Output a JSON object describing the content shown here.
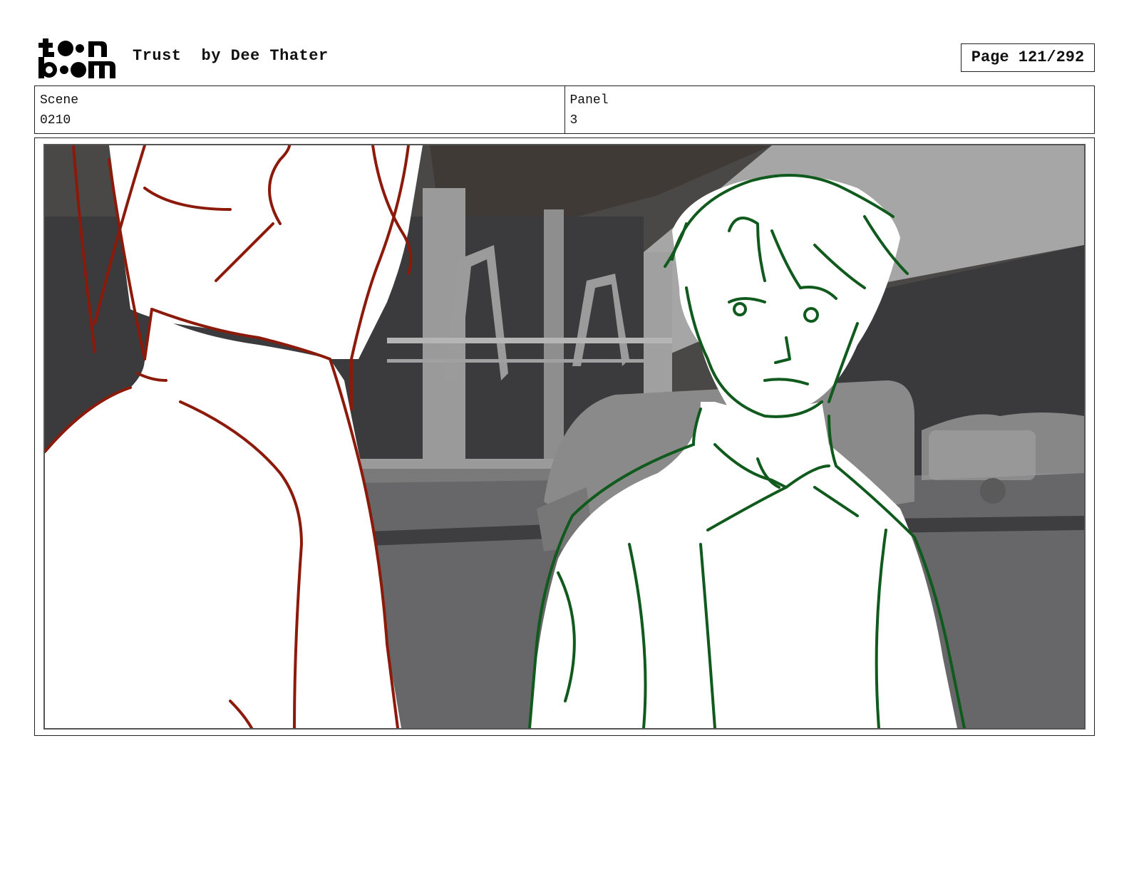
{
  "header": {
    "logo_text": "toon boom",
    "title": "Trust",
    "author": "by Dee Thater",
    "page": "Page 121/292"
  },
  "meta": {
    "scene_label": "Scene",
    "scene_value": "0210",
    "panel_label": "Panel",
    "panel_value": "3"
  },
  "colors": {
    "left_character_line": "#8b1a0a",
    "right_character_line": "#0f5a1c",
    "background_gray": "#6e6e70"
  }
}
